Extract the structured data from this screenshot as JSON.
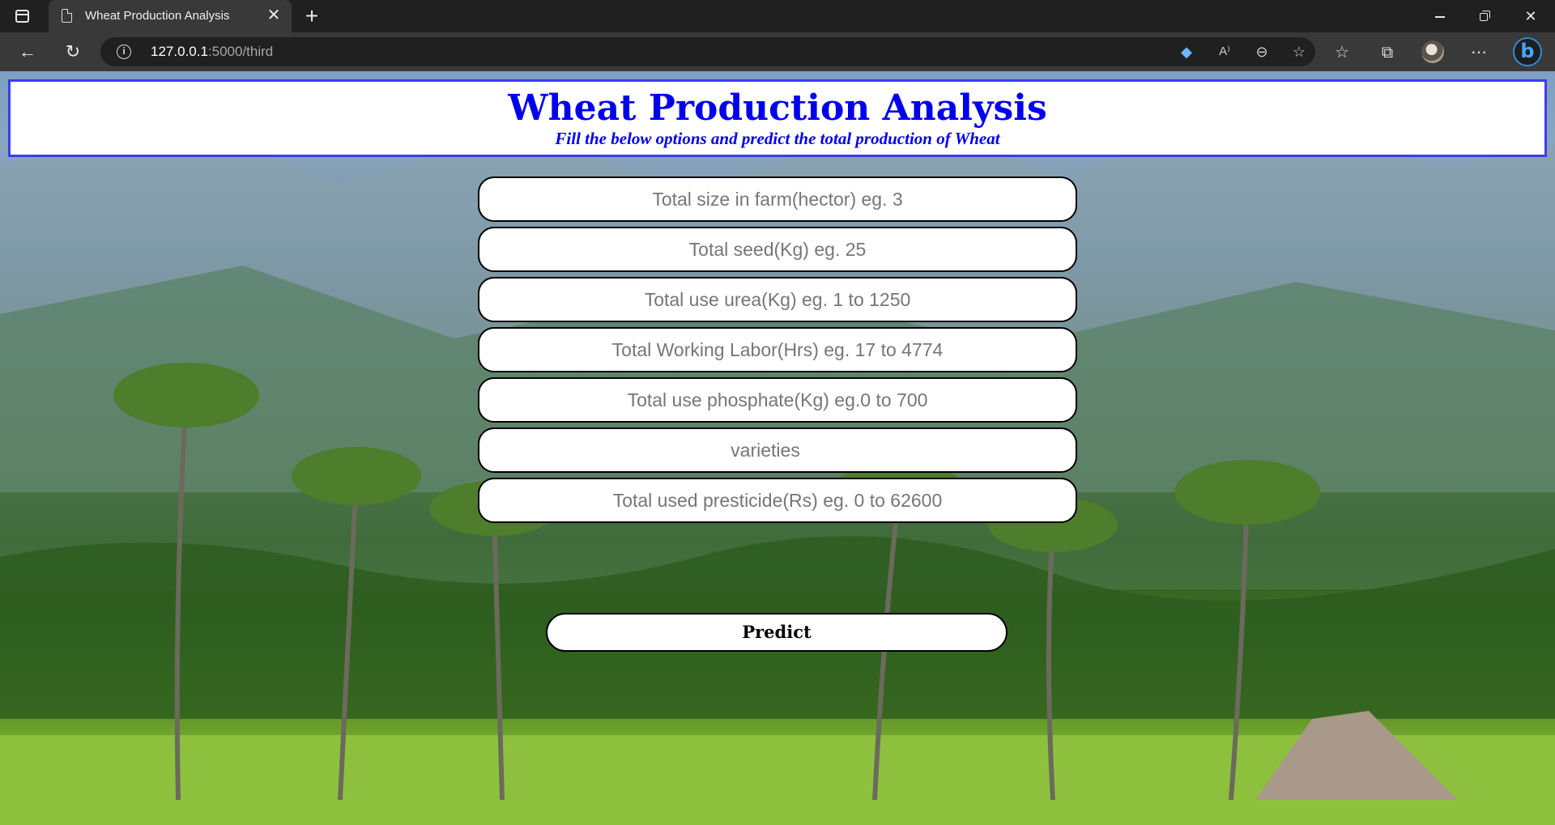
{
  "browser": {
    "tab_title": "Wheat Production Analysis",
    "new_tab_symbol": "+",
    "url_host": "127.0.0.1",
    "url_path": ":5000/third",
    "icons": {
      "tab_actions": "tab-strip-icon",
      "page": "page-icon",
      "close_tab": "close-icon",
      "back": "back-arrow-icon",
      "reload": "reload-icon",
      "site_info": "info-icon",
      "coupon": "tag-icon",
      "read_aloud": "read-aloud-icon",
      "zoom_out": "zoom-out-icon",
      "add_favorite": "star-plus-icon",
      "favorites": "favorites-icon",
      "collections": "collections-icon",
      "profile": "avatar",
      "more": "more-icon",
      "copilot": "bing-icon"
    }
  },
  "page": {
    "title": "Wheat Production Analysis",
    "subtitle": "Fill the below options and predict the total production of Wheat",
    "fields": [
      {
        "placeholder": "Total size in farm(hector) eg. 3"
      },
      {
        "placeholder": "Total seed(Kg) eg. 25"
      },
      {
        "placeholder": "Total use urea(Kg) eg. 1 to 1250"
      },
      {
        "placeholder": "Total Working Labor(Hrs) eg. 17 to 4774"
      },
      {
        "placeholder": "Total use phosphate(Kg) eg.0 to 700"
      }
    ],
    "varieties_select": "varieties",
    "pesticide_field": {
      "placeholder": "Total used presticide(Rs) eg. 0 to 62600"
    },
    "predict_label": "Predict"
  },
  "colors": {
    "header_text": "#0000ee",
    "header_border": "#3b3bf5"
  }
}
